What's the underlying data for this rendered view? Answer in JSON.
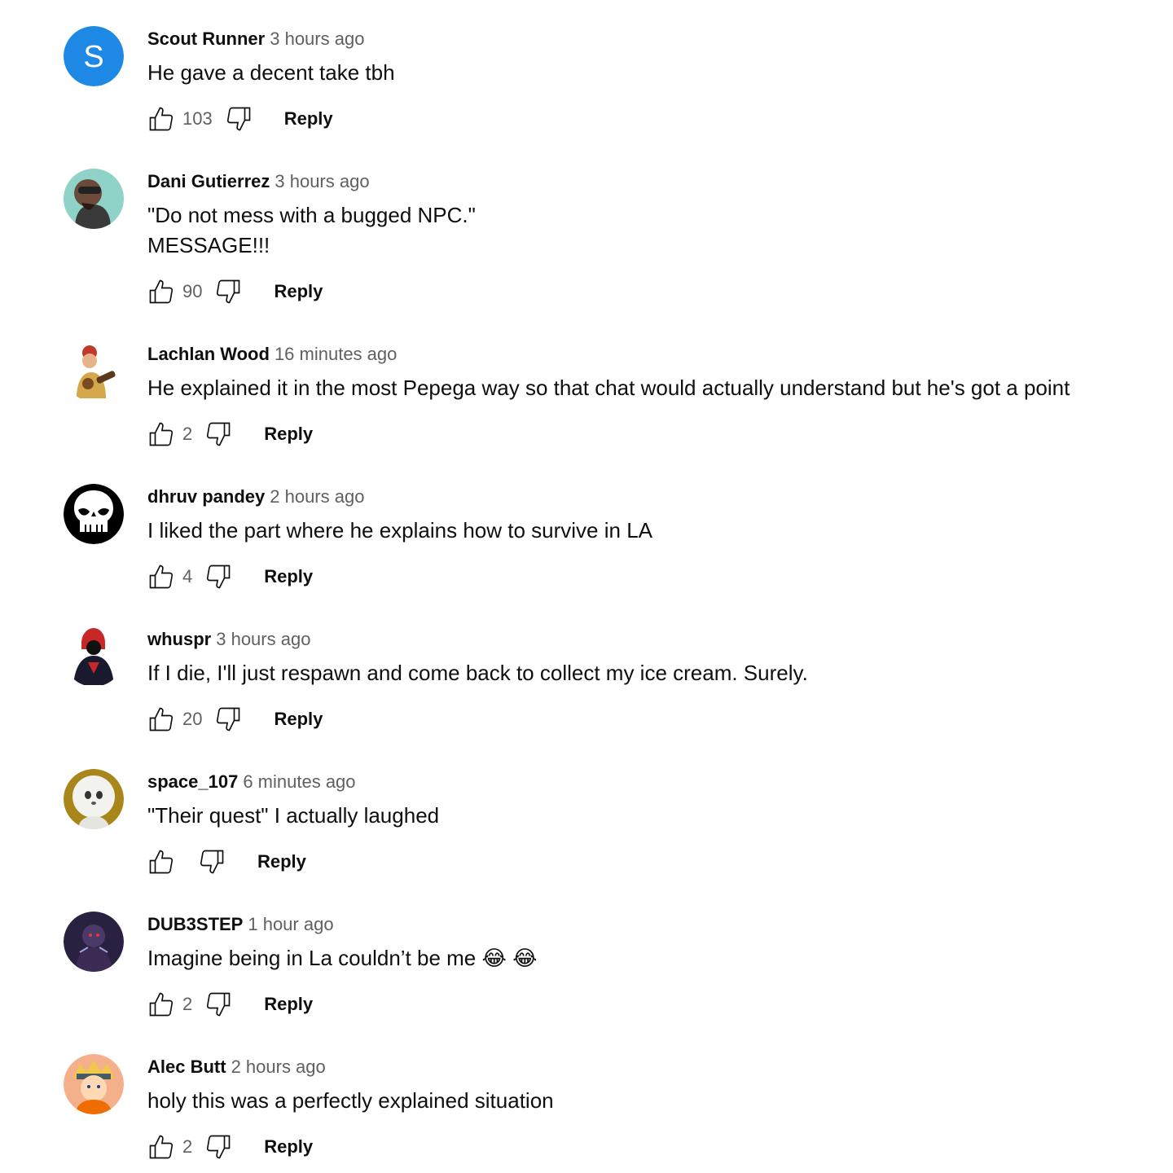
{
  "comments": [
    {
      "author": "Scout Runner",
      "time": "3 hours ago",
      "text": "He gave a decent take tbh",
      "likes": "103",
      "reply_label": "Reply",
      "avatar": {
        "type": "letter",
        "letter": "S",
        "color": "#1e88e5"
      }
    },
    {
      "author": "Dani Gutierrez",
      "time": "3 hours ago",
      "text": "\"Do not mess with a bugged NPC.\"\nMESSAGE!!!",
      "likes": "90",
      "reply_label": "Reply",
      "avatar": {
        "type": "photo",
        "color": "#8fd3c8"
      }
    },
    {
      "author": "Lachlan Wood",
      "time": "16 minutes ago",
      "text": "He explained it in the most Pepega way so that chat would actually understand but he's got a point",
      "likes": "2",
      "reply_label": "Reply",
      "avatar": {
        "type": "photo",
        "color": "#ffffff"
      }
    },
    {
      "author": "dhruv pandey",
      "time": "2 hours ago",
      "text": "I liked the part where he explains how to survive in LA",
      "likes": "4",
      "reply_label": "Reply",
      "avatar": {
        "type": "skull",
        "color": "#000000"
      }
    },
    {
      "author": "whuspr",
      "time": "3 hours ago",
      "text": "If I die, I'll just respawn and come back to collect my ice cream. Surely.",
      "likes": "20",
      "reply_label": "Reply",
      "avatar": {
        "type": "photo",
        "color": "#ffffff"
      }
    },
    {
      "author": "space_107",
      "time": "6 minutes ago",
      "text": "\"Their quest\" I actually laughed",
      "likes": "",
      "reply_label": "Reply",
      "avatar": {
        "type": "photo",
        "color": "#a8861a"
      }
    },
    {
      "author": "DUB3STEP",
      "time": "1 hour ago",
      "text": "Imagine being in La couldn’t be me 😂 😂",
      "likes": "2",
      "reply_label": "Reply",
      "avatar": {
        "type": "photo",
        "color": "#2a2140"
      }
    },
    {
      "author": "Alec Butt",
      "time": "2 hours ago",
      "text": "holy this was a perfectly explained situation",
      "likes": "2",
      "reply_label": "Reply",
      "avatar": {
        "type": "photo",
        "color": "#f3b08a"
      }
    }
  ]
}
